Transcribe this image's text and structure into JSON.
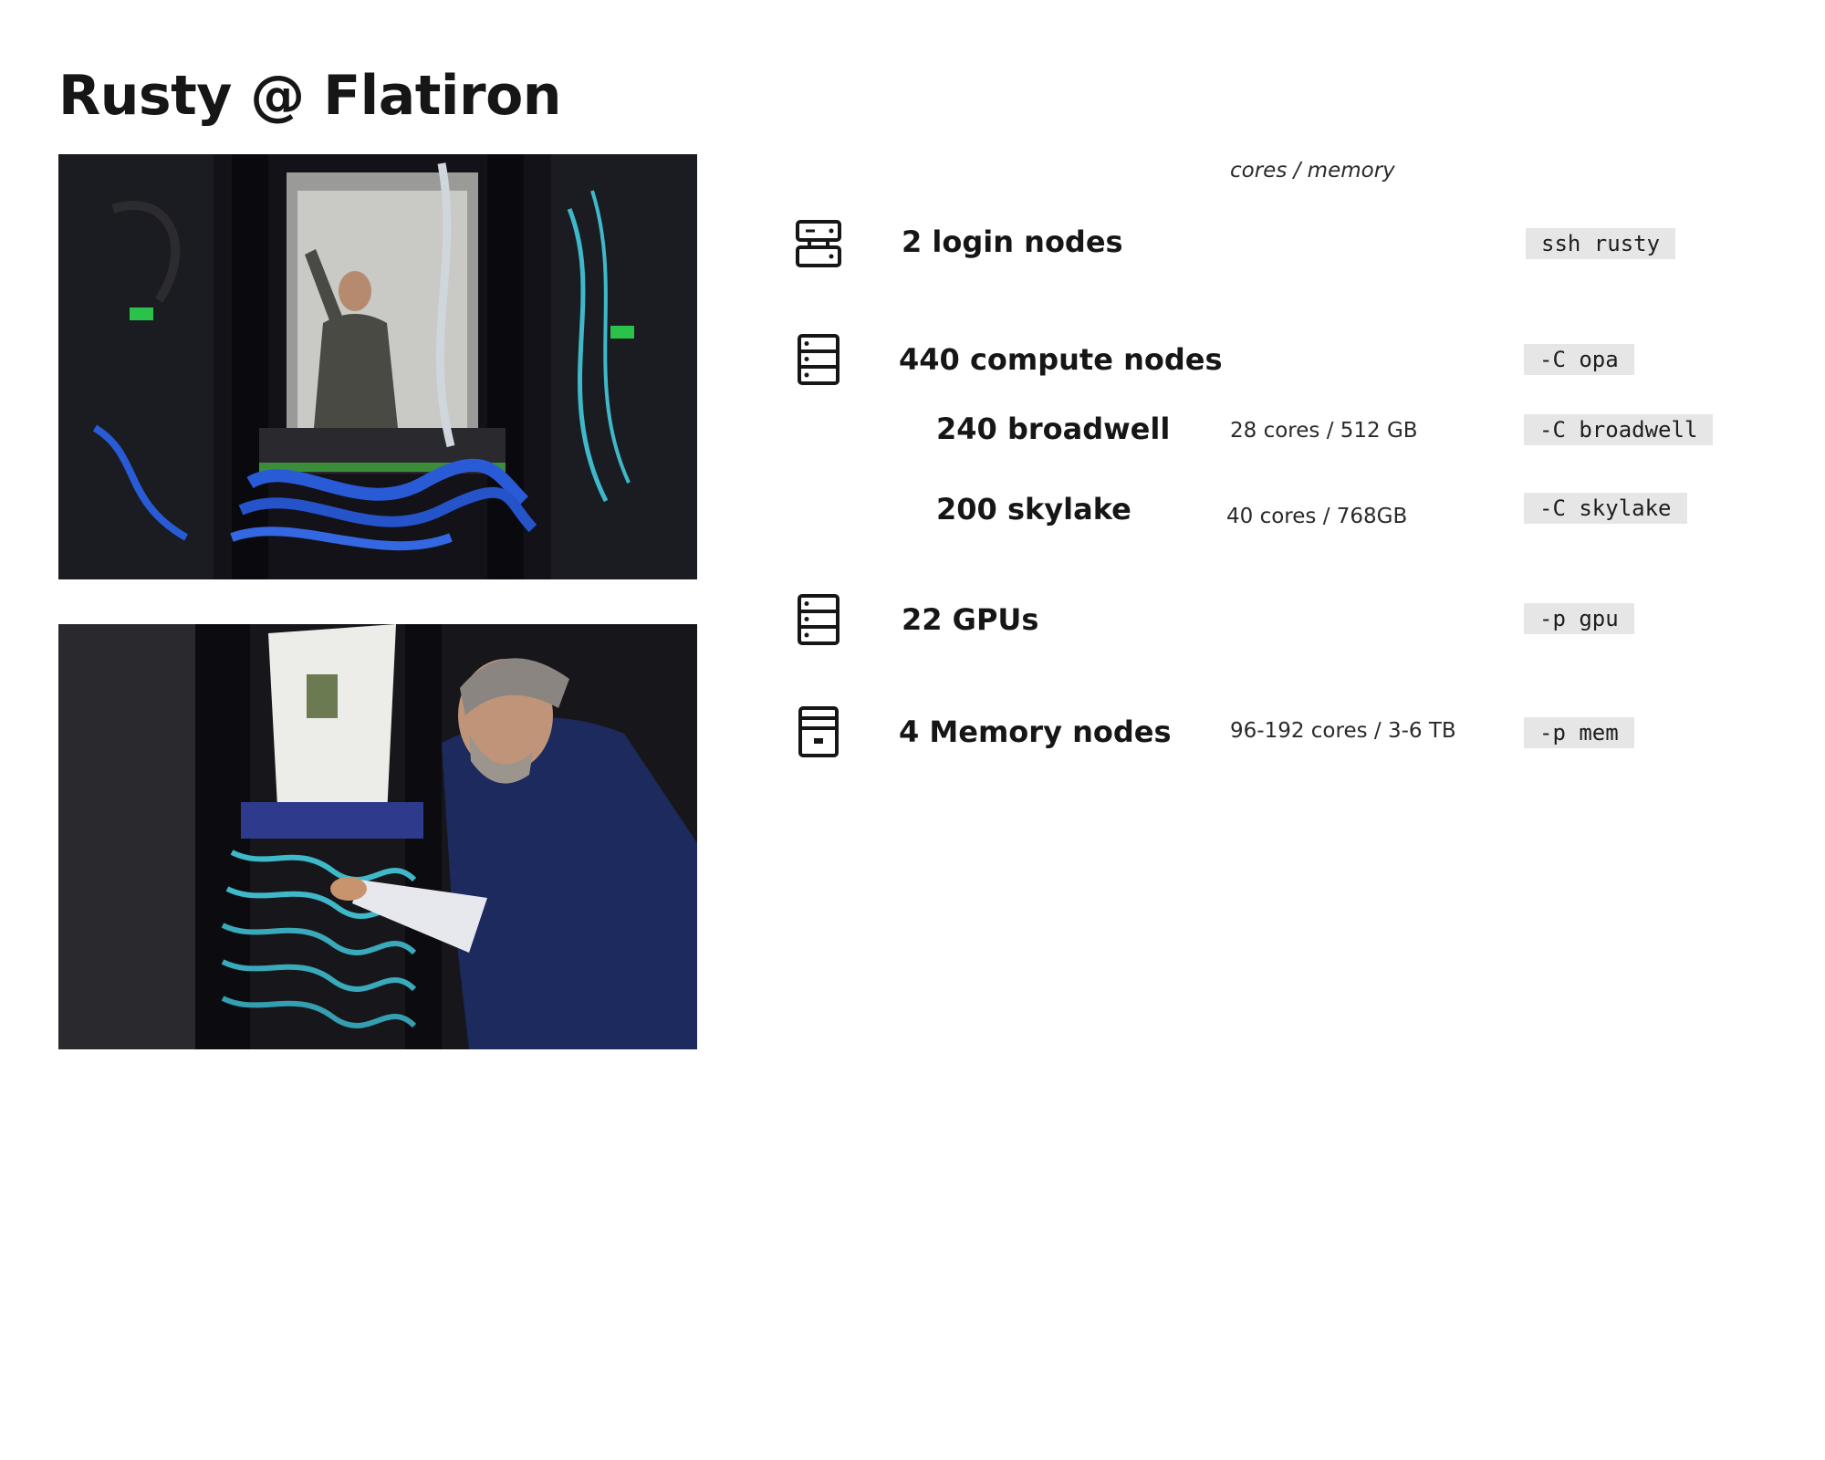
{
  "title": "Rusty @ Flatiron",
  "specs": {
    "column_header": "cores / memory",
    "rows": [
      {
        "icon": "login-server-icon",
        "label": "2 login nodes",
        "spec": "",
        "flag": "ssh rusty"
      },
      {
        "icon": "server-rack-icon",
        "label": "440 compute nodes",
        "spec": "",
        "flag": "-C opa"
      },
      {
        "icon": "",
        "label": "240 broadwell",
        "spec": "28 cores / 512 GB",
        "flag": "-C broadwell"
      },
      {
        "icon": "",
        "label": "200 skylake",
        "spec": "40 cores / 768GB",
        "flag": "-C skylake"
      },
      {
        "icon": "server-rack-icon",
        "label": "22 GPUs",
        "spec": "",
        "flag": "-p gpu"
      },
      {
        "icon": "storage-server-icon",
        "label": "4 Memory nodes",
        "spec": "96-192 cores / 3-6 TB",
        "flag": "-p mem"
      }
    ]
  },
  "colors": {
    "text": "#161616",
    "flag_background": "#e6e6e6",
    "cable_blue": "#2a5bd7",
    "cable_cyan": "#3fb8c9"
  }
}
